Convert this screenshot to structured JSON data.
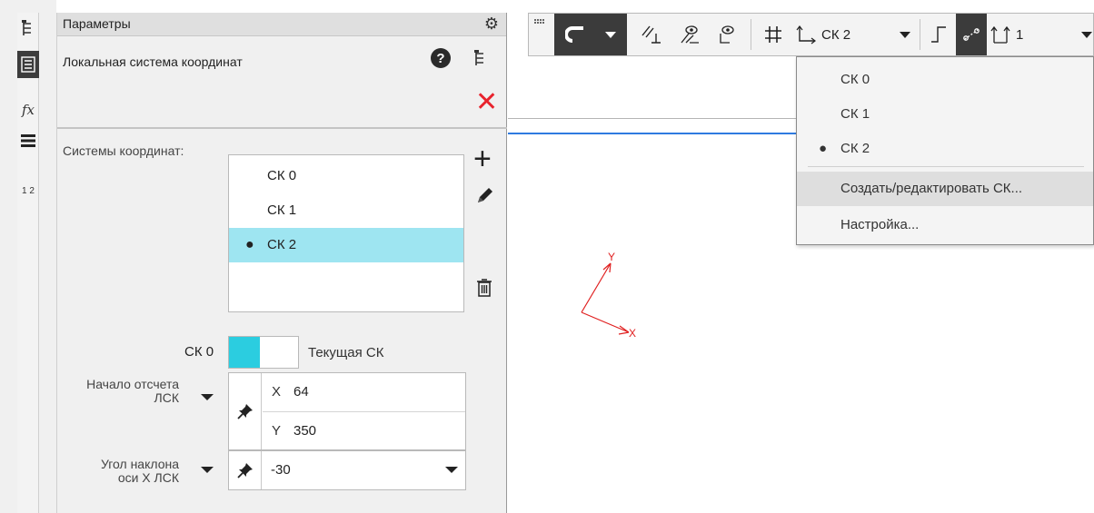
{
  "strip": {
    "icons": [
      "tree-icon",
      "properties-icon",
      "fx-icon",
      "layers-icon",
      "swap-icon"
    ],
    "fx_label": "fx",
    "swap_label": "1 2"
  },
  "panel": {
    "title": "Параметры",
    "command_title": "Локальная система координат",
    "help_symbol": "?",
    "close_symbol": "✕",
    "coordinate_systems_label": "Системы координат:",
    "coordinate_systems": [
      {
        "label": "СК 0",
        "selected": false
      },
      {
        "label": "СК 1",
        "selected": false
      },
      {
        "label": "СК 2",
        "selected": true
      }
    ],
    "bullet": "●",
    "add_symbol": "+",
    "switch_left_label": "СК 0",
    "switch_right_label": "Текущая СК",
    "origin_label_line1": "Начало отсчета",
    "origin_label_line2": "ЛСК",
    "x_axis_label": "X",
    "x_value": "64",
    "y_axis_label": "Y",
    "y_value": "350",
    "angle_label_line1": "Угол наклона",
    "angle_label_line2": "оси X ЛСК",
    "angle_value": "-30"
  },
  "toolbar": {
    "current_cs": "СК 2",
    "step_value": "1"
  },
  "dropdown_menu": {
    "items": [
      {
        "label": "СК 0",
        "checked": false
      },
      {
        "label": "СК 1",
        "checked": false
      },
      {
        "label": "СК 2",
        "checked": true
      },
      {
        "label": "Создать/редактировать СК...",
        "checked": false,
        "hover": true
      },
      {
        "label": "Настройка...",
        "checked": false
      }
    ]
  },
  "canvas": {
    "axis_x_label": "X",
    "axis_y_label": "Y"
  },
  "colors": {
    "accent_cyan": "#2bcde0",
    "selection": "#9ee5f1",
    "close_red": "#e8232d",
    "axis_red": "#e01f1f",
    "blue_line": "#2f7be0",
    "toolbar_dark": "#3b3b3b"
  }
}
